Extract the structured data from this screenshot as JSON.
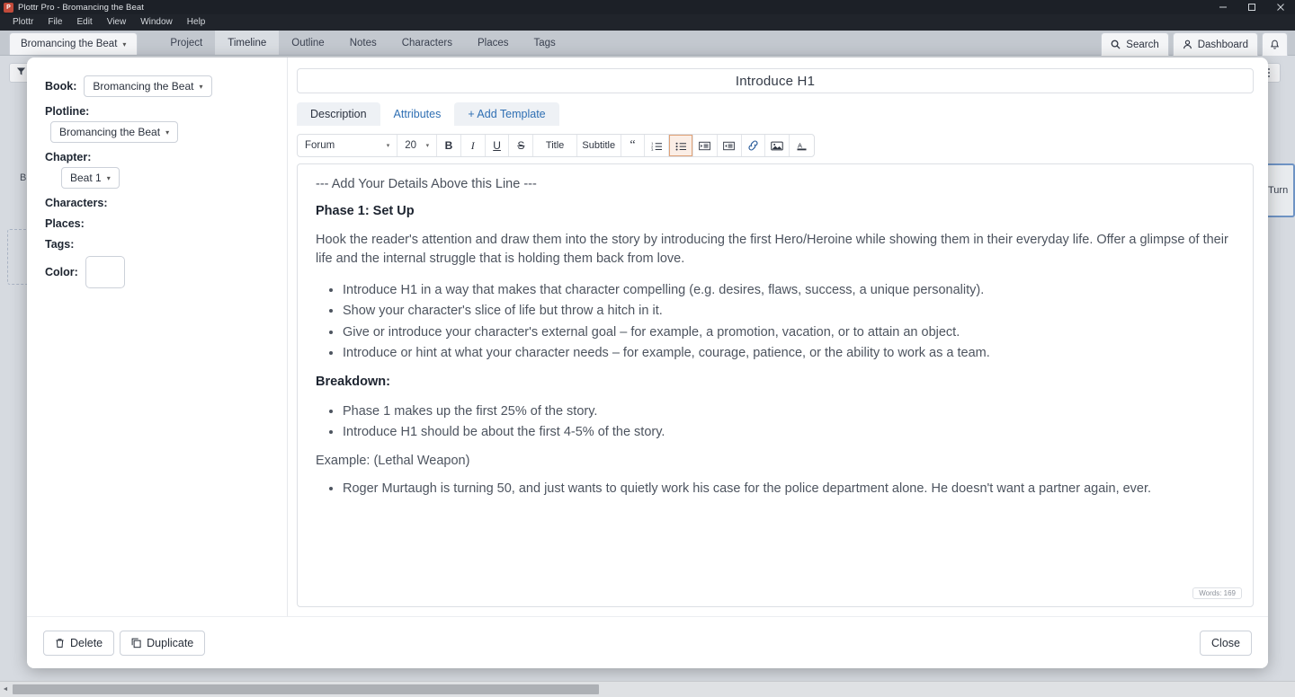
{
  "window": {
    "app_icon": "plottr-icon",
    "title": "Plottr Pro - Bromancing the Beat",
    "minimize": "–",
    "maximize": "☐",
    "close": "×"
  },
  "menubar": {
    "items": [
      {
        "label": "Plottr"
      },
      {
        "label": "File"
      },
      {
        "label": "Edit"
      },
      {
        "label": "View"
      },
      {
        "label": "Window"
      },
      {
        "label": "Help"
      }
    ]
  },
  "tabstrip": {
    "book_tab": {
      "label": "Bromancing the Beat",
      "caret": "▾"
    },
    "nav_tabs": [
      {
        "label": "Project",
        "active": false
      },
      {
        "label": "Timeline",
        "active": true
      },
      {
        "label": "Outline",
        "active": false
      },
      {
        "label": "Notes",
        "active": false
      },
      {
        "label": "Characters",
        "active": false
      },
      {
        "label": "Places",
        "active": false
      },
      {
        "label": "Tags",
        "active": false
      }
    ],
    "right_buttons": [
      {
        "label": "Search",
        "icon": "search-icon"
      },
      {
        "label": "Dashboard",
        "icon": "user-icon"
      }
    ],
    "notification_icon": "bell-icon"
  },
  "workspace": {
    "filter_icon": "filter-icon",
    "kebab_icon": "vertical-dots-icon",
    "row_label": "B",
    "background_card_text": "Turn"
  },
  "modal": {
    "meta": {
      "book_label": "Book:",
      "book_value": "Bromancing the Beat",
      "plotline_label": "Plotline:",
      "plotline_value": "Bromancing the Beat",
      "chapter_label": "Chapter:",
      "chapter_value": "Beat 1",
      "characters_label": "Characters:",
      "places_label": "Places:",
      "tags_label": "Tags:",
      "color_label": "Color:",
      "color_value": "#ffffff",
      "caret": "▾"
    },
    "editor": {
      "doc_title": "Introduce H1",
      "tabs": [
        {
          "label": "Description",
          "active": true
        },
        {
          "label": "Attributes",
          "active": false
        },
        {
          "label": "+ Add Template",
          "active": false
        }
      ],
      "toolbar": {
        "font_family": "Forum",
        "font_size": "20",
        "caret": "▾",
        "buttons": [
          {
            "name": "bold-icon",
            "label": "B",
            "active": false
          },
          {
            "name": "italic-icon",
            "label": "I",
            "active": false
          },
          {
            "name": "underline-icon",
            "label": "U",
            "active": false
          },
          {
            "name": "strikethrough-icon",
            "label": "S",
            "active": false
          },
          {
            "name": "title-button",
            "label": "Title",
            "active": false
          },
          {
            "name": "subtitle-button",
            "label": "Subtitle",
            "active": false
          },
          {
            "name": "blockquote-icon",
            "label": "“",
            "active": false
          },
          {
            "name": "ordered-list-icon",
            "label": "",
            "active": false
          },
          {
            "name": "bullet-list-icon",
            "label": "",
            "active": true
          },
          {
            "name": "indent-icon",
            "label": "",
            "active": false
          },
          {
            "name": "outdent-icon",
            "label": "",
            "active": false
          },
          {
            "name": "link-icon",
            "label": "",
            "active": false
          },
          {
            "name": "image-icon",
            "label": "",
            "active": false
          },
          {
            "name": "text-color-icon",
            "label": "A",
            "active": false
          }
        ]
      },
      "content": {
        "lead": "--- Add Your Details Above this Line ---",
        "heading_phase": "Phase 1: Set Up",
        "paragraph": "Hook the reader's attention and draw them into the story by introducing the first Hero/Heroine while showing them in their everyday life. Offer a glimpse of their life and the internal struggle that is holding them back from love.",
        "bullets_setup": [
          "Introduce H1 in a way that makes that character compelling (e.g. desires, flaws, success, a unique personality).",
          "Show your character's slice of life but throw a hitch in it.",
          "Give or introduce your character's external goal – for example, a promotion, vacation, or to attain an object.",
          "Introduce or hint at what your character needs – for example, courage, patience, or the ability to work as a team."
        ],
        "heading_breakdown": "Breakdown:",
        "bullets_breakdown": [
          "Phase 1 makes up the first 25% of the story.",
          "Introduce H1 should be about the first 4-5% of the story."
        ],
        "example_label": "Example: (Lethal Weapon)",
        "bullets_example": [
          "Roger Murtaugh is turning 50, and just wants to quietly work his case for the police department alone. He doesn't want a partner again, ever."
        ],
        "word_count": "Words: 169"
      }
    },
    "footer": {
      "delete_label": "Delete",
      "duplicate_label": "Duplicate",
      "close_label": "Close"
    }
  },
  "colors": {
    "accent": "#2f6fb3",
    "active_tool": "#e0a277",
    "card_border": "#6e93c4"
  }
}
